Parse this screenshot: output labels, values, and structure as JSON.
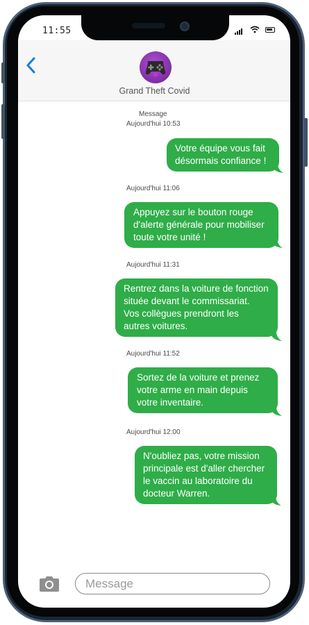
{
  "status_bar": {
    "time": "11:55"
  },
  "header": {
    "contact_name": "Grand Theft Covid",
    "avatar_icon": "gamepad-icon"
  },
  "conversation": {
    "service_label": "Message",
    "messages": [
      {
        "timestamp": "Aujourd'hui 10:53",
        "text_lines": [
          "Votre équipe vous fait",
          "désormais confiance !"
        ]
      },
      {
        "timestamp": "Aujourd'hui 11:06",
        "text_lines": [
          "Appuyez sur le bouton rouge",
          "d'alerte générale pour mobiliser",
          "toute votre unité !"
        ]
      },
      {
        "timestamp": "Aujourd'hui 11:31",
        "text_lines": [
          "Rentrez dans la voiture de fonction",
          "située devant le commissariat.",
          "Vos collègues prendront les",
          "autres voitures."
        ]
      },
      {
        "timestamp": "Aujourd'hui 11:52",
        "text_lines": [
          "Sortez de la voiture et prenez",
          "votre arme en main depuis",
          "votre inventaire."
        ]
      },
      {
        "timestamp": "Aujourd'hui 12:00",
        "text_lines": [
          "N'oubliez pas, votre mission",
          "principale est d'aller chercher",
          "le vaccin au laboratoire du",
          "docteur Warren."
        ]
      }
    ]
  },
  "composer": {
    "placeholder": "Message",
    "camera_icon": "camera-icon"
  },
  "colors": {
    "bubble": "#2fad48",
    "back_chevron": "#1a7ae0",
    "frame": "#1c2631"
  }
}
